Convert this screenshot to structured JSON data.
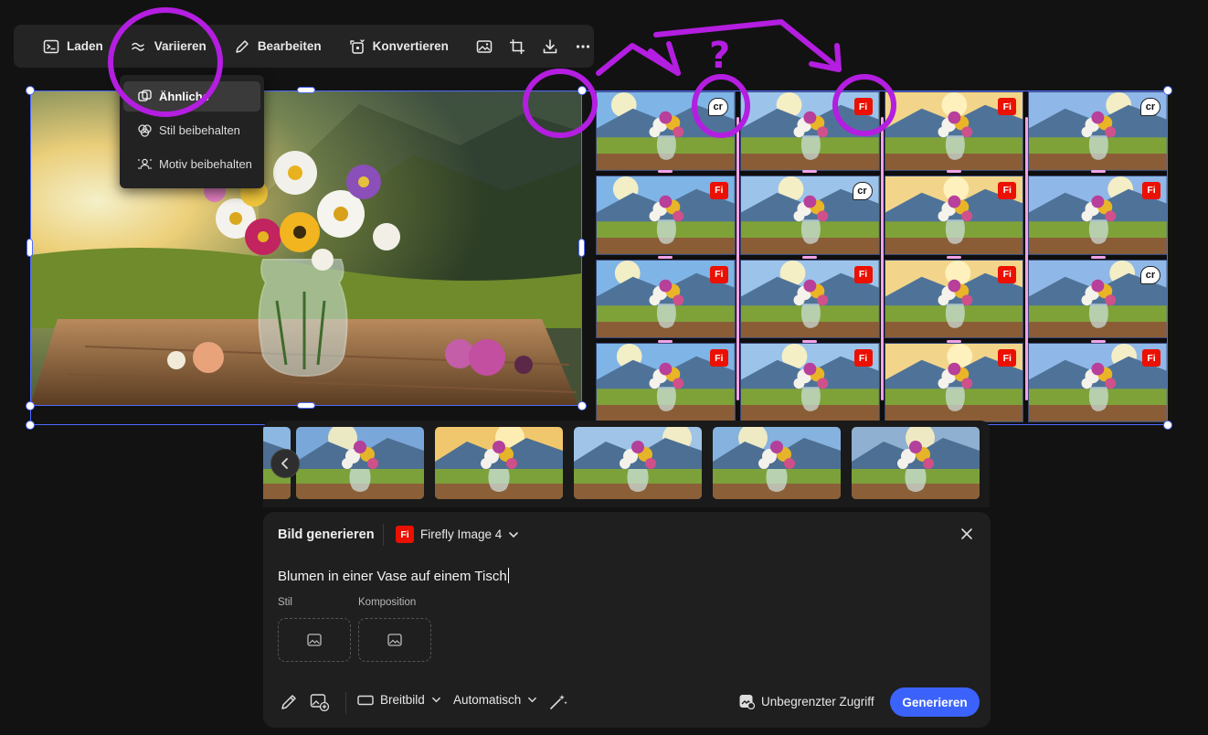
{
  "toolbar": {
    "load_label": "Laden",
    "vary_label": "Variieren",
    "edit_label": "Bearbeiten",
    "convert_label": "Konvertieren"
  },
  "vary_menu": {
    "items": [
      {
        "label": "Ähnliche"
      },
      {
        "label": "Stil beibehalten"
      },
      {
        "label": "Motiv beibehalten"
      }
    ]
  },
  "badges": {
    "fi": "Fi",
    "cr": "cr"
  },
  "grid_badges": [
    "cr",
    "Fi",
    "Fi",
    "cr",
    "Fi",
    "cr",
    "Fi",
    "Fi",
    "Fi",
    "Fi",
    "Fi",
    "cr",
    "Fi",
    "Fi",
    "Fi",
    "Fi"
  ],
  "annotation": {
    "question_mark": "?"
  },
  "panel": {
    "title": "Bild generieren",
    "model": "Firefly Image 4",
    "model_badge": "Fi",
    "prompt": "Blumen in einer Vase auf einem Tisch",
    "style_label": "Stil",
    "composition_label": "Komposition",
    "aspect": "Breitbild",
    "content_type": "Automatisch",
    "access_label": "Unbegrenzter Zugriff",
    "generate_label": "Generieren"
  },
  "colors": {
    "accent": "#3b63fb",
    "selection": "#4f6bff",
    "annotation": "#b41ee0",
    "fi_badge": "#eb1000"
  }
}
